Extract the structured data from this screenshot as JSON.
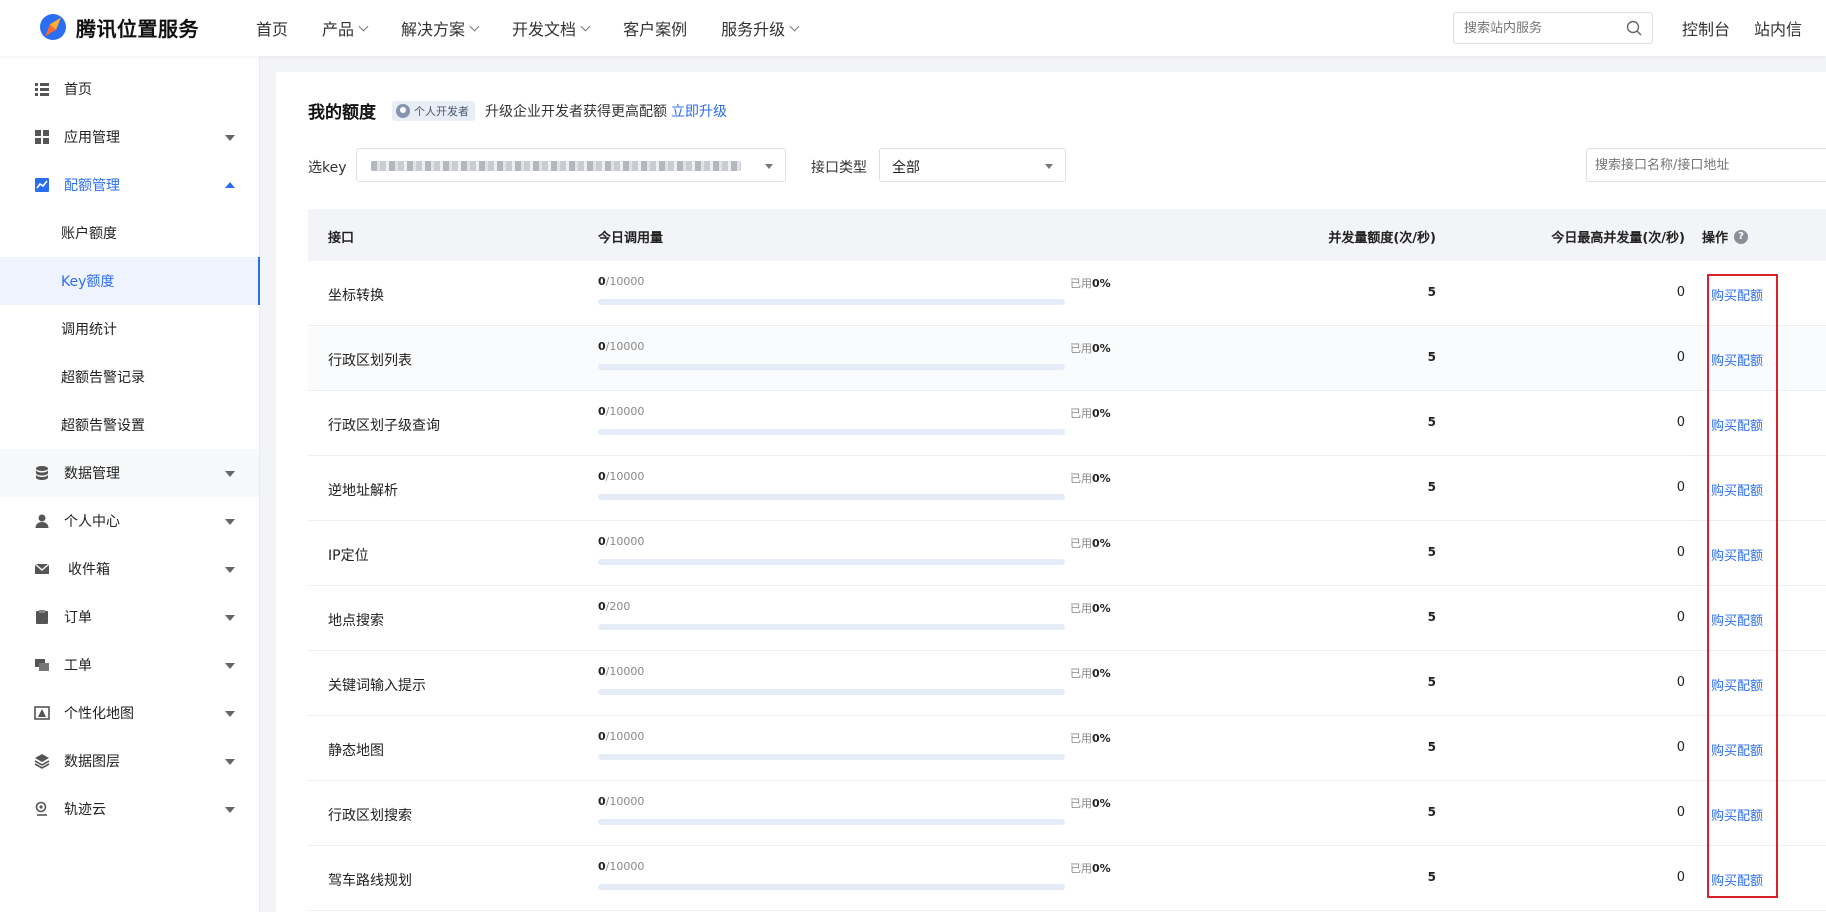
{
  "brand": {
    "name": "腾讯位置服务"
  },
  "nav": {
    "items": [
      {
        "label": "首页",
        "dropdown": false
      },
      {
        "label": "产品",
        "dropdown": true
      },
      {
        "label": "解决方案",
        "dropdown": true
      },
      {
        "label": "开发文档",
        "dropdown": true
      },
      {
        "label": "客户案例",
        "dropdown": false
      },
      {
        "label": "服务升级",
        "dropdown": true
      }
    ],
    "search_placeholder": "搜索站内服务",
    "console": "控制台",
    "messages": "站内信"
  },
  "sidebar": {
    "home": "首页",
    "app_mgmt": "应用管理",
    "quota_mgmt": "配额管理",
    "sub_items": [
      "账户额度",
      "Key额度",
      "调用统计",
      "超额告警记录",
      "超额告警设置"
    ],
    "data_mgmt": "数据管理",
    "personal": "个人中心",
    "inbox": "收件箱",
    "orders": "订单",
    "tickets": "工单",
    "custom_map": "个性化地图",
    "data_layer": "数据图层",
    "trail_cloud": "轨迹云"
  },
  "main": {
    "title": "我的额度",
    "badge": "个人开发者",
    "upgrade_text": "升级企业开发者获得更高配额",
    "upgrade_link": "立即升级",
    "select_key_label": "选key",
    "api_type_label": "接口类型",
    "api_type_value": "全部",
    "api_search_placeholder": "搜索接口名称/接口地址"
  },
  "table": {
    "headers": {
      "api": "接口",
      "today_calls": "今日调用量",
      "concurrency": "并发量额度(次/秒)",
      "max_concurrency": "今日最高并发量(次/秒)",
      "operation": "操作"
    },
    "used_label": "已用",
    "rows": [
      {
        "name": "坐标转换",
        "used": "0",
        "limit": "/10000",
        "pct": "0%",
        "pct_value": 0,
        "concurrency": "5",
        "max": "0",
        "action": "购买配额"
      },
      {
        "name": "行政区划列表",
        "used": "0",
        "limit": "/10000",
        "pct": "0%",
        "pct_value": 0,
        "concurrency": "5",
        "max": "0",
        "action": "购买配额"
      },
      {
        "name": "行政区划子级查询",
        "used": "0",
        "limit": "/10000",
        "pct": "0%",
        "pct_value": 0,
        "concurrency": "5",
        "max": "0",
        "action": "购买配额"
      },
      {
        "name": "逆地址解析",
        "used": "0",
        "limit": "/10000",
        "pct": "0%",
        "pct_value": 0,
        "concurrency": "5",
        "max": "0",
        "action": "购买配额"
      },
      {
        "name": "IP定位",
        "used": "0",
        "limit": "/10000",
        "pct": "0%",
        "pct_value": 0,
        "concurrency": "5",
        "max": "0",
        "action": "购买配额"
      },
      {
        "name": "地点搜索",
        "used": "0",
        "limit": "/200",
        "pct": "0%",
        "pct_value": 0,
        "concurrency": "5",
        "max": "0",
        "action": "购买配额"
      },
      {
        "name": "关键词输入提示",
        "used": "0",
        "limit": "/10000",
        "pct": "0%",
        "pct_value": 0,
        "concurrency": "5",
        "max": "0",
        "action": "购买配额"
      },
      {
        "name": "静态地图",
        "used": "0",
        "limit": "/10000",
        "pct": "0%",
        "pct_value": 0,
        "concurrency": "5",
        "max": "0",
        "action": "购买配额"
      },
      {
        "name": "行政区划搜索",
        "used": "0",
        "limit": "/10000",
        "pct": "0%",
        "pct_value": 0,
        "concurrency": "5",
        "max": "0",
        "action": "购买配额"
      },
      {
        "name": "驾车路线规划",
        "used": "0",
        "limit": "/10000",
        "pct": "0%",
        "pct_value": 0,
        "concurrency": "5",
        "max": "0",
        "action": "购买配额"
      }
    ]
  },
  "colors": {
    "accent": "#2c6ef2",
    "highlight_box": "#d9232c"
  }
}
